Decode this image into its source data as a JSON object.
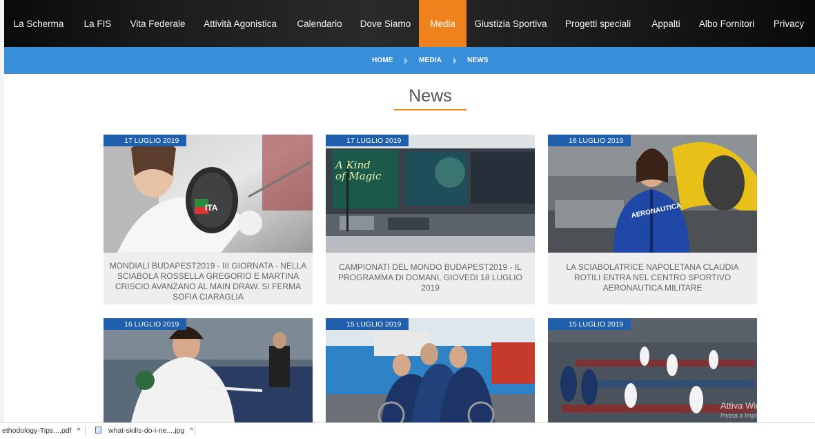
{
  "nav": {
    "items": [
      "La Scherma",
      "La FIS",
      "Vita Federale",
      "Attività Agonistica",
      "Calendario",
      "Dove Siamo",
      "Media",
      "Giustizia Sportiva",
      "Progetti speciali",
      "Appalti",
      "Albo Fornitori",
      "Privacy"
    ],
    "active": "Media"
  },
  "breadcrumb": [
    "HOME",
    "MEDIA",
    "NEWS"
  ],
  "page": {
    "title": "News"
  },
  "cards": [
    {
      "date": "17 LUGLIO 2019",
      "title": "MONDIALI BUDAPEST2019 - III GIORNATA - NELLA SCIABOLA ROSSELLA GREGORIO E MARTINA CRISCIO AVANZANO AL MAIN DRAW. SI FERMA SOFIA CIARAGLIA",
      "photo_text": "ITA"
    },
    {
      "date": "17 LUGLIO 2019",
      "title": "CAMPIONATI DEL MONDO BUDAPEST2019 - IL PROGRAMMA DI DOMANI, GIOVEDI 18 LUGLIO 2019",
      "photo_text": "A Kind of Magic"
    },
    {
      "date": "16 LUGLIO 2019",
      "title": "LA SCIABOLATRICE NAPOLETANA CLAUDIA ROTILI ENTRA NEL CENTRO SPORTIVO AERONAUTICA MILITARE",
      "photo_text": "AERONAUTICA"
    },
    {
      "date": "16 LUGLIO 2019",
      "title": "",
      "photo_text": ""
    },
    {
      "date": "15 LUGLIO 2019",
      "title": "",
      "photo_text": ""
    },
    {
      "date": "15 LUGLIO 2019",
      "title": "",
      "photo_text": ""
    }
  ],
  "os_overlay": {
    "line1": "Attiva Windows",
    "line2": "Passa a Impostazioni per attivare Windows."
  },
  "downloads": [
    {
      "name": "ethodology-Tips....pdf",
      "chevron": "^"
    },
    {
      "name": "what-skills-do-i-ne....jpg",
      "chevron": "^"
    }
  ],
  "colors": {
    "accent": "#f0821e",
    "breadcrumb_bar": "#3a8fdb",
    "date_badge": "#1f5fae",
    "nav_bg": "#111111"
  }
}
